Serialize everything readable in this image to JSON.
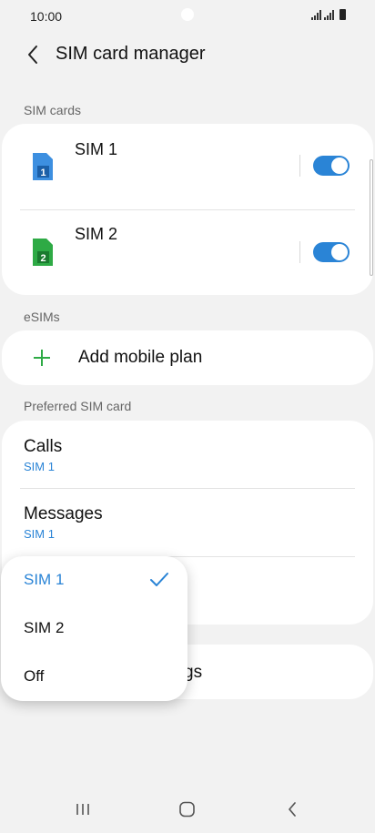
{
  "status_bar": {
    "time": "10:00"
  },
  "header": {
    "title": "SIM card manager"
  },
  "sim_cards": {
    "section_label": "SIM cards",
    "items": [
      {
        "name": "SIM 1",
        "icon_number": "1",
        "icon_color": "#3d8fe0",
        "enabled": true
      },
      {
        "name": "SIM 2",
        "icon_number": "2",
        "icon_color": "#2eaa45",
        "enabled": true
      }
    ]
  },
  "esims": {
    "section_label": "eSIMs",
    "add_label": "Add mobile plan"
  },
  "preferred": {
    "section_label": "Preferred SIM card",
    "items": [
      {
        "title": "Calls",
        "value": "SIM 1"
      },
      {
        "title": "Messages",
        "value": "SIM 1"
      }
    ]
  },
  "more_settings": {
    "label_tail": "gs"
  },
  "popup": {
    "options": [
      {
        "label": "SIM 1",
        "selected": true
      },
      {
        "label": "SIM 2",
        "selected": false
      },
      {
        "label": "Off",
        "selected": false
      }
    ]
  },
  "colors": {
    "accent": "#2a84d6",
    "background": "#f2f2f2",
    "card": "#ffffff",
    "plus": "#2eaa45"
  },
  "icons": {
    "back": "chevron-left-icon",
    "plus": "plus-icon",
    "check": "check-icon",
    "nav_recents": "recents-icon",
    "nav_home": "home-icon",
    "nav_back": "back-icon"
  }
}
